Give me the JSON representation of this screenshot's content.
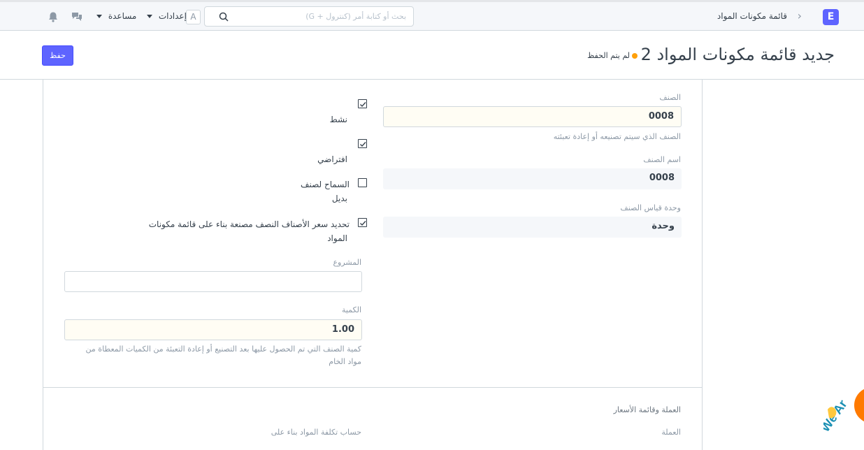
{
  "navbar": {
    "logo": "E",
    "breadcrumb": "قائمة مكونات المواد",
    "search_placeholder": "بحث أو كتابة أمر (كنترول + G)",
    "avatar": "A",
    "settings_label": "إعدادات",
    "help_label": "مساعدة"
  },
  "page": {
    "title": "جديد قائمة مكونات المواد 2",
    "status": "لم يتم الحفظ",
    "save_label": "حفظ"
  },
  "form": {
    "item": {
      "label": "الصنف",
      "value": "0008",
      "help": "الصنف الذي سيتم تصنيعه أو إعادة تعبئته"
    },
    "item_name": {
      "label": "اسم الصنف",
      "value": "0008"
    },
    "uom": {
      "label": "وحدة قياس الصنف",
      "value": "وحدة"
    },
    "is_active": {
      "label": "نشط",
      "checked": true
    },
    "is_default": {
      "label": "افتراضي",
      "checked": true
    },
    "allow_alternative": {
      "label_line1": "السماح لصنف",
      "label_line2": "بديل",
      "checked": false
    },
    "update_rate": {
      "label_line1": "تحديد سعر الأصناف النصف مصنعة بناء على قائمة مكونات",
      "label_line2": "المواد",
      "checked": true
    },
    "project": {
      "label": "المشروع",
      "value": ""
    },
    "quantity": {
      "label": "الكمية",
      "value": "1.00",
      "help_line1": "كمية الصنف التي تم الحصول عليها بعد التصنيع أو إعادة التعبئة من الكميات المعطاة من",
      "help_line2": "مواد الخام"
    },
    "currency_section": {
      "title": "العملة وقائمة الأسعار",
      "currency_label": "العملة",
      "costing_label": "حساب تكلفة المواد بناء على"
    }
  },
  "colors": {
    "primary": "#5e64ff",
    "unsaved_dot": "#ffa00a",
    "chat": "#ff7a00"
  }
}
